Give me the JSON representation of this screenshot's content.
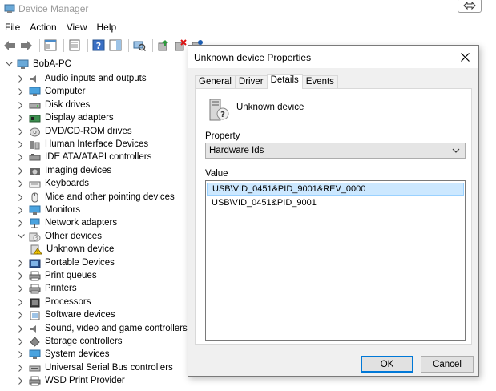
{
  "window": {
    "title": "Device Manager"
  },
  "menu": [
    "File",
    "Action",
    "View",
    "Help"
  ],
  "toolbar_icons": [
    "back-arrow-icon",
    "forward-arrow-icon",
    "show-hide-tree-icon",
    "properties-icon",
    "help-icon",
    "action-pane-icon",
    "scan-hardware-icon",
    "update-driver-icon",
    "uninstall-device-icon",
    "disable-device-icon"
  ],
  "tree": {
    "root": "BobA-PC",
    "items": [
      {
        "label": "Audio inputs and outputs",
        "icon": "speaker-icon"
      },
      {
        "label": "Computer",
        "icon": "monitor-icon"
      },
      {
        "label": "Disk drives",
        "icon": "disk-icon"
      },
      {
        "label": "Display adapters",
        "icon": "display-adapter-icon"
      },
      {
        "label": "DVD/CD-ROM drives",
        "icon": "dvd-icon"
      },
      {
        "label": "Human Interface Devices",
        "icon": "hid-icon"
      },
      {
        "label": "IDE ATA/ATAPI controllers",
        "icon": "ide-icon"
      },
      {
        "label": "Imaging devices",
        "icon": "camera-icon"
      },
      {
        "label": "Keyboards",
        "icon": "keyboard-icon"
      },
      {
        "label": "Mice and other pointing devices",
        "icon": "mouse-icon"
      },
      {
        "label": "Monitors",
        "icon": "monitor-icon"
      },
      {
        "label": "Network adapters",
        "icon": "network-icon"
      },
      {
        "label": "Other devices",
        "icon": "other-devices-icon",
        "expanded": true
      },
      {
        "label": "Unknown device",
        "icon": "warning-device-icon",
        "child": true
      },
      {
        "label": "Portable Devices",
        "icon": "portable-icon"
      },
      {
        "label": "Print queues",
        "icon": "printer-icon"
      },
      {
        "label": "Printers",
        "icon": "printer-icon"
      },
      {
        "label": "Processors",
        "icon": "cpu-icon"
      },
      {
        "label": "Software devices",
        "icon": "software-icon"
      },
      {
        "label": "Sound, video and game controllers",
        "icon": "speaker-icon"
      },
      {
        "label": "Storage controllers",
        "icon": "storage-icon"
      },
      {
        "label": "System devices",
        "icon": "system-icon"
      },
      {
        "label": "Universal Serial Bus controllers",
        "icon": "usb-icon"
      },
      {
        "label": "WSD Print Provider",
        "icon": "printer-icon"
      }
    ]
  },
  "dialog": {
    "title": "Unknown device Properties",
    "tabs": [
      "General",
      "Driver",
      "Details",
      "Events"
    ],
    "active_tab": "Details",
    "device_name": "Unknown device",
    "property_label": "Property",
    "property_value": "Hardware Ids",
    "value_label": "Value",
    "values": [
      "USB\\VID_0451&PID_9001&REV_0000",
      "USB\\VID_0451&PID_9001"
    ],
    "ok_label": "OK",
    "cancel_label": "Cancel"
  },
  "colors": {
    "selection": "#cce8ff",
    "accent": "#0078d7"
  }
}
